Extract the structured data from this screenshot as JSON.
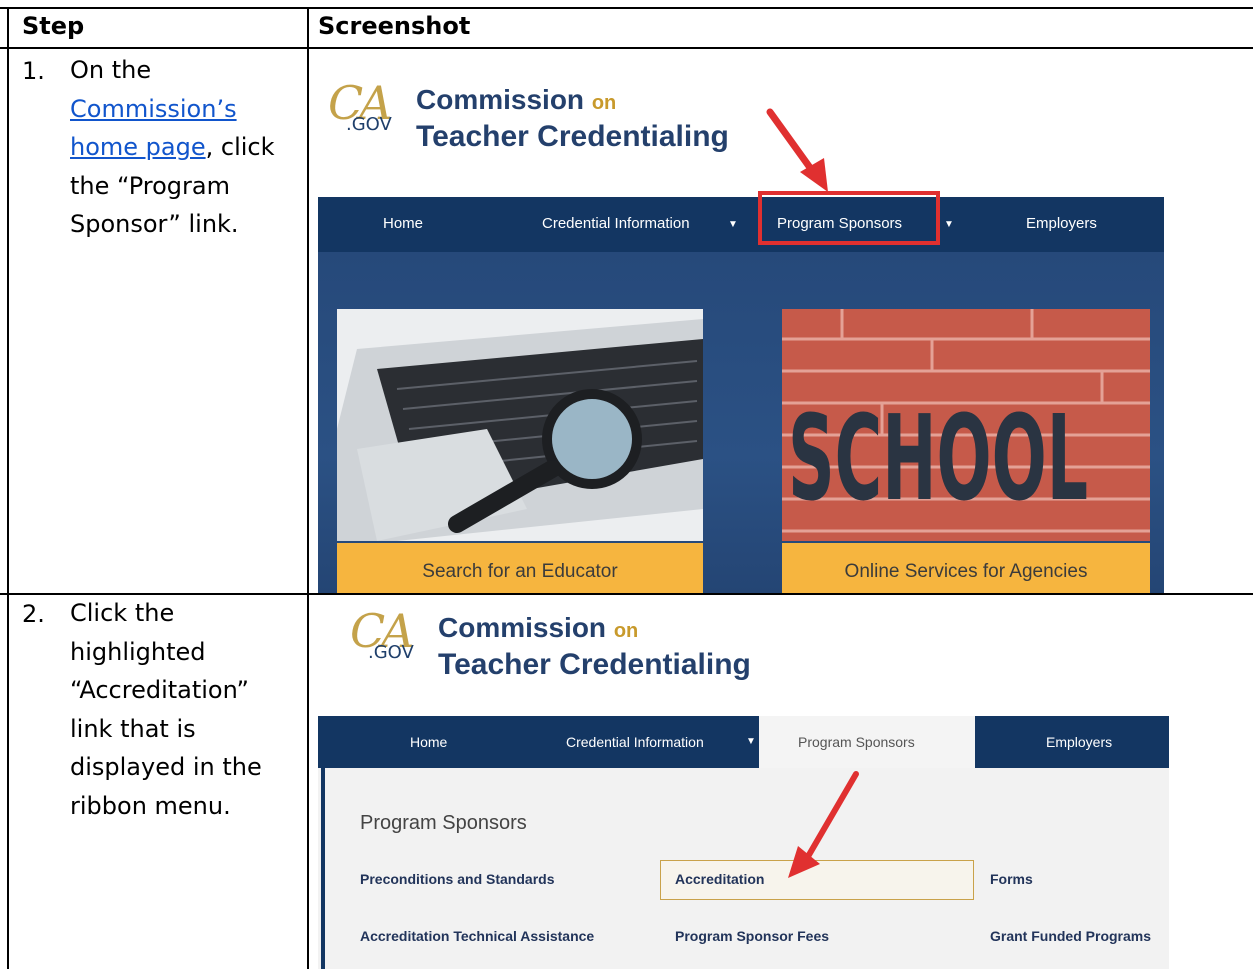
{
  "table": {
    "headers": [
      "Step",
      "Screenshot"
    ],
    "rows": [
      {
        "number": "1.",
        "text_before": "On the",
        "link": "Commission’s home page",
        "text_after": ", click the “Program Sponsor” link."
      },
      {
        "number": "2.",
        "text": "Click the highlighted “Accreditation” link that is displayed in the ribbon menu."
      }
    ]
  },
  "screenshot1": {
    "logo": {
      "ca": "CA",
      "gov": ".GOV",
      "line1": "Commission",
      "on": "on",
      "line2": "Teacher Credentialing"
    },
    "nav": [
      "Home",
      "Credential Information",
      "Program Sponsors",
      "Employers"
    ],
    "tiles": [
      "Search for an Educator",
      "Online Services for Agencies"
    ],
    "school_text": "SCHOOL"
  },
  "screenshot2": {
    "logo": {
      "ca": "CA",
      "gov": ".GOV",
      "line1": "Commission",
      "on": "on",
      "line2": "Teacher Credentialing"
    },
    "nav": [
      "Home",
      "Credential Information",
      "Program Sponsors",
      "Employers"
    ],
    "menu_title": "Program Sponsors",
    "menu_links": [
      "Preconditions and Standards",
      "Accreditation",
      "Forms",
      "Accreditation Technical Assistance",
      "Program Sponsor Fees",
      "Grant Funded Programs"
    ]
  },
  "colors": {
    "navy": "#133662",
    "gold": "#c99a2b",
    "tile_orange": "#f6b53f",
    "highlight_red": "#e03030",
    "link_blue": "#1155cc"
  }
}
